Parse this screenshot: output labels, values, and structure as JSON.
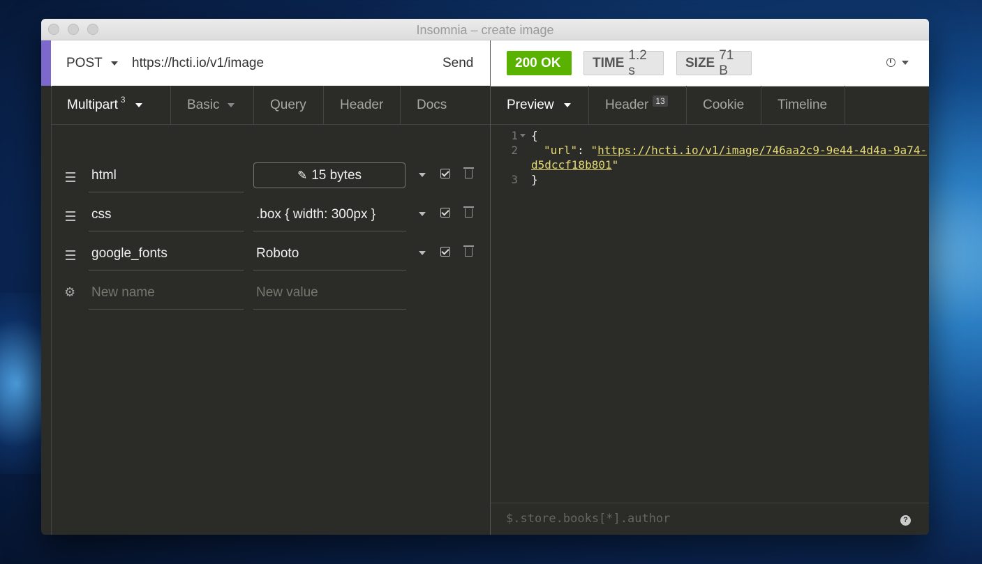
{
  "window": {
    "title": "Insomnia – create image"
  },
  "request": {
    "method": "POST",
    "url": "https://hcti.io/v1/image",
    "send_label": "Send"
  },
  "request_tabs": [
    {
      "label": "Multipart",
      "badge": "3",
      "active": true
    },
    {
      "label": "Basic"
    },
    {
      "label": "Query"
    },
    {
      "label": "Header"
    },
    {
      "label": "Docs"
    }
  ],
  "params": [
    {
      "name": "html",
      "value": "15 bytes",
      "is_file": true
    },
    {
      "name": "css",
      "value": ".box { width: 300px }"
    },
    {
      "name": "google_fonts",
      "value": "Roboto"
    }
  ],
  "new_param": {
    "name_placeholder": "New name",
    "value_placeholder": "New value"
  },
  "response": {
    "status": "200 OK",
    "status_color": "#59b200",
    "time_label": "TIME",
    "time_value": "1.2 s",
    "size_label": "SIZE",
    "size_value": "71 B"
  },
  "response_tabs": [
    {
      "label": "Preview",
      "active": true
    },
    {
      "label": "Header",
      "badge": "13"
    },
    {
      "label": "Cookie"
    },
    {
      "label": "Timeline"
    }
  ],
  "code": {
    "line_numbers": [
      "1",
      "2",
      "3"
    ],
    "open_brace": "{",
    "key": "\"url\"",
    "colon": ": ",
    "quote": "\"",
    "url_part1": "https://hcti.io/v1/image/746aa2c9-9e44-4d4a-9a74-",
    "url_part2": "d5dccf18b801",
    "close_brace": "}"
  },
  "filter": {
    "placeholder": "$.store.books[*].author"
  },
  "icons": {
    "drag": "drag-handle-icon",
    "check": "checkbox-checked-icon",
    "trash": "trash-icon",
    "gear": "gear-icon",
    "edit": "edit-icon",
    "clock": "clock-icon",
    "help": "help-icon"
  }
}
